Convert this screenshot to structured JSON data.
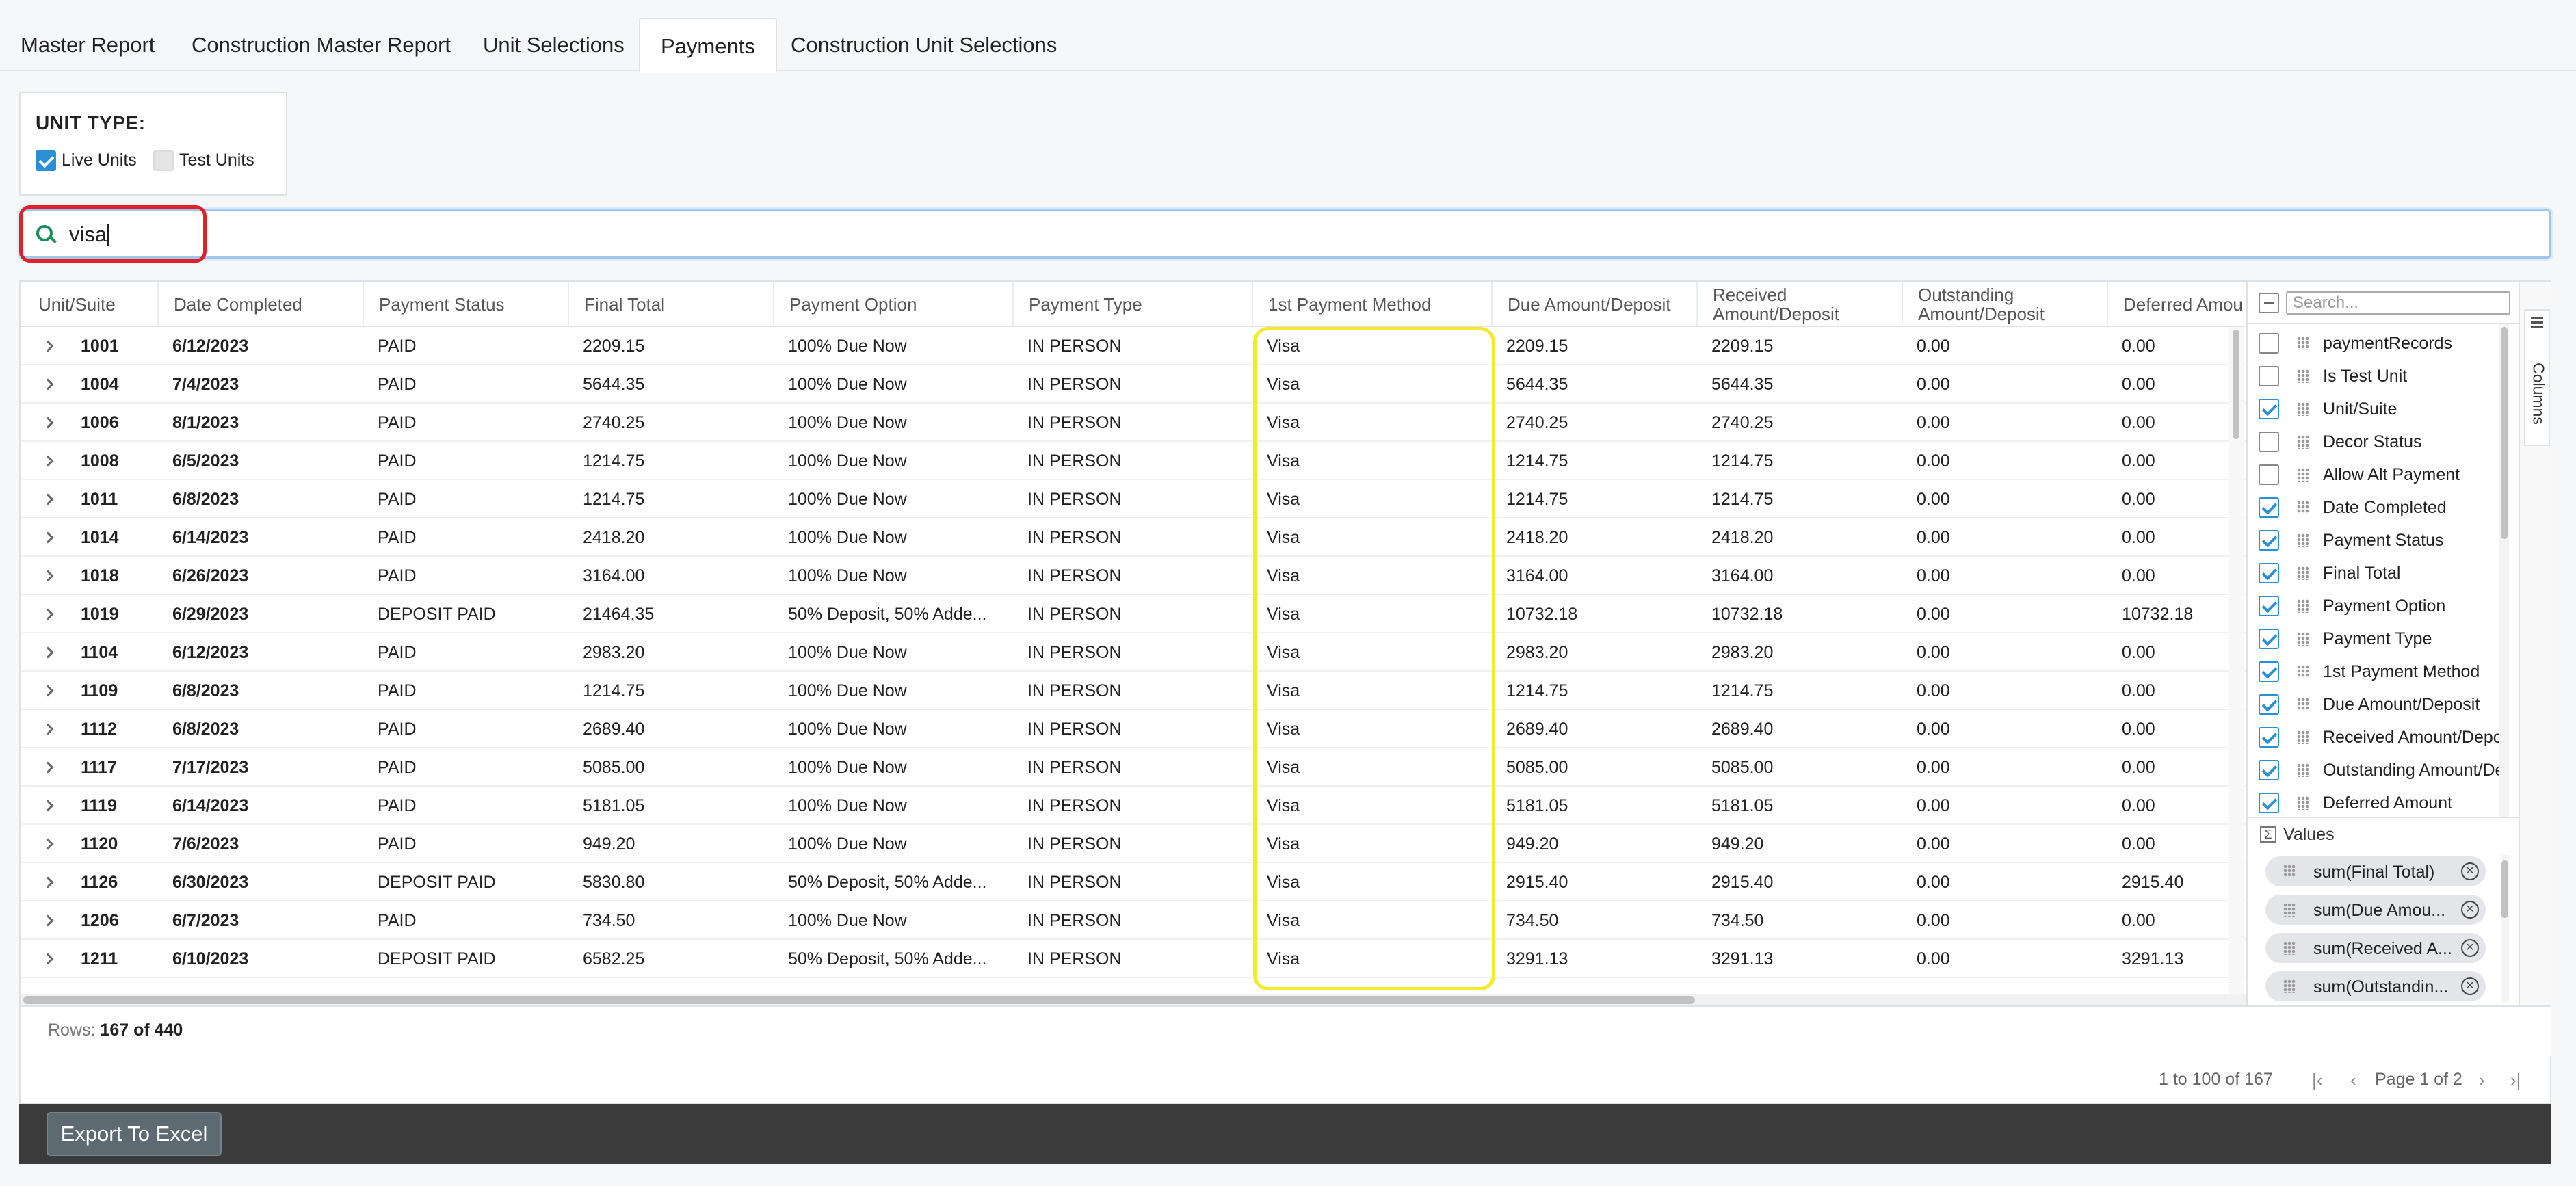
{
  "tabs": [
    {
      "label": "Master Report"
    },
    {
      "label": "Construction Master Report"
    },
    {
      "label": "Unit Selections"
    },
    {
      "label": "Payments"
    },
    {
      "label": "Construction Unit Selections"
    }
  ],
  "unit_type": {
    "title": "UNIT TYPE:",
    "live_label": "Live Units",
    "live_checked": true,
    "test_label": "Test Units",
    "test_checked": false
  },
  "search": {
    "value": "visa"
  },
  "grid": {
    "columns": [
      "Unit/Suite",
      "Date Completed",
      "Payment Status",
      "Final Total",
      "Payment Option",
      "Payment Type",
      "1st Payment Method",
      "Due Amount/Deposit",
      "Received Amount/Deposit",
      "Outstanding Amount/Deposit",
      "Deferred Amou"
    ],
    "rows": [
      [
        "1001",
        "6/12/2023",
        "PAID",
        "2209.15",
        "100% Due Now",
        "IN PERSON",
        "Visa",
        "2209.15",
        "2209.15",
        "0.00",
        "0.00"
      ],
      [
        "1004",
        "7/4/2023",
        "PAID",
        "5644.35",
        "100% Due Now",
        "IN PERSON",
        "Visa",
        "5644.35",
        "5644.35",
        "0.00",
        "0.00"
      ],
      [
        "1006",
        "8/1/2023",
        "PAID",
        "2740.25",
        "100% Due Now",
        "IN PERSON",
        "Visa",
        "2740.25",
        "2740.25",
        "0.00",
        "0.00"
      ],
      [
        "1008",
        "6/5/2023",
        "PAID",
        "1214.75",
        "100% Due Now",
        "IN PERSON",
        "Visa",
        "1214.75",
        "1214.75",
        "0.00",
        "0.00"
      ],
      [
        "1011",
        "6/8/2023",
        "PAID",
        "1214.75",
        "100% Due Now",
        "IN PERSON",
        "Visa",
        "1214.75",
        "1214.75",
        "0.00",
        "0.00"
      ],
      [
        "1014",
        "6/14/2023",
        "PAID",
        "2418.20",
        "100% Due Now",
        "IN PERSON",
        "Visa",
        "2418.20",
        "2418.20",
        "0.00",
        "0.00"
      ],
      [
        "1018",
        "6/26/2023",
        "PAID",
        "3164.00",
        "100% Due Now",
        "IN PERSON",
        "Visa",
        "3164.00",
        "3164.00",
        "0.00",
        "0.00"
      ],
      [
        "1019",
        "6/29/2023",
        "DEPOSIT PAID",
        "21464.35",
        "50% Deposit, 50% Adde...",
        "IN PERSON",
        "Visa",
        "10732.18",
        "10732.18",
        "0.00",
        "10732.18"
      ],
      [
        "1104",
        "6/12/2023",
        "PAID",
        "2983.20",
        "100% Due Now",
        "IN PERSON",
        "Visa",
        "2983.20",
        "2983.20",
        "0.00",
        "0.00"
      ],
      [
        "1109",
        "6/8/2023",
        "PAID",
        "1214.75",
        "100% Due Now",
        "IN PERSON",
        "Visa",
        "1214.75",
        "1214.75",
        "0.00",
        "0.00"
      ],
      [
        "1112",
        "6/8/2023",
        "PAID",
        "2689.40",
        "100% Due Now",
        "IN PERSON",
        "Visa",
        "2689.40",
        "2689.40",
        "0.00",
        "0.00"
      ],
      [
        "1117",
        "7/17/2023",
        "PAID",
        "5085.00",
        "100% Due Now",
        "IN PERSON",
        "Visa",
        "5085.00",
        "5085.00",
        "0.00",
        "0.00"
      ],
      [
        "1119",
        "6/14/2023",
        "PAID",
        "5181.05",
        "100% Due Now",
        "IN PERSON",
        "Visa",
        "5181.05",
        "5181.05",
        "0.00",
        "0.00"
      ],
      [
        "1120",
        "7/6/2023",
        "PAID",
        "949.20",
        "100% Due Now",
        "IN PERSON",
        "Visa",
        "949.20",
        "949.20",
        "0.00",
        "0.00"
      ],
      [
        "1126",
        "6/30/2023",
        "DEPOSIT PAID",
        "5830.80",
        "50% Deposit, 50% Adde...",
        "IN PERSON",
        "Visa",
        "2915.40",
        "2915.40",
        "0.00",
        "2915.40"
      ],
      [
        "1206",
        "6/7/2023",
        "PAID",
        "734.50",
        "100% Due Now",
        "IN PERSON",
        "Visa",
        "734.50",
        "734.50",
        "0.00",
        "0.00"
      ],
      [
        "1211",
        "6/10/2023",
        "DEPOSIT PAID",
        "6582.25",
        "50% Deposit, 50% Adde...",
        "IN PERSON",
        "Visa",
        "3291.13",
        "3291.13",
        "0.00",
        "3291.13"
      ]
    ],
    "rows_label": "Rows:",
    "rows_value": "167 of 440"
  },
  "columns_panel": {
    "filter_placeholder": "Search...",
    "side_label": "Columns",
    "items": [
      {
        "label": "paymentRecords",
        "checked": false
      },
      {
        "label": "Is Test Unit",
        "checked": false
      },
      {
        "label": "Unit/Suite",
        "checked": true
      },
      {
        "label": "Decor Status",
        "checked": false
      },
      {
        "label": "Allow Alt Payment",
        "checked": false
      },
      {
        "label": "Date Completed",
        "checked": true
      },
      {
        "label": "Payment Status",
        "checked": true
      },
      {
        "label": "Final Total",
        "checked": true
      },
      {
        "label": "Payment Option",
        "checked": true
      },
      {
        "label": "Payment Type",
        "checked": true
      },
      {
        "label": "1st Payment Method",
        "checked": true
      },
      {
        "label": "Due Amount/Deposit",
        "checked": true
      },
      {
        "label": "Received Amount/Deposit",
        "checked": true
      },
      {
        "label": "Outstanding Amount/Deposit",
        "checked": true
      },
      {
        "label": "Deferred Amount",
        "checked": true
      }
    ],
    "values_label": "Values",
    "values": [
      "sum(Final Total)",
      "sum(Due Amou...",
      "sum(Received A...",
      "sum(Outstandin..."
    ]
  },
  "pager": {
    "summary": "1 to 100 of 167",
    "page_text": "Page 1 of 2"
  },
  "export": {
    "label": "Export To Excel"
  },
  "colors": {
    "accent": "#2b8fd6",
    "search_highlight": "#e0202b",
    "column_highlight": "#f2ea2a",
    "footer_bar": "#3b3b3b"
  }
}
